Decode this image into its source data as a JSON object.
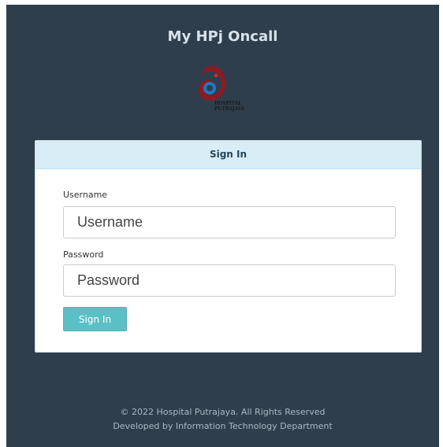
{
  "app": {
    "title": "My HPj Oncall"
  },
  "logo": {
    "line1": "HOSPITAL",
    "line2": "PUTRAJAYA",
    "colors": {
      "maroon": "#8b1a22",
      "blue": "#1e7ac2",
      "accent": "#d32f2f"
    }
  },
  "login": {
    "header": "Sign In",
    "username_label": "Username",
    "username_placeholder": "Username",
    "username_value": "",
    "password_label": "Password",
    "password_placeholder": "Password",
    "password_value": "",
    "submit_label": "Sign In"
  },
  "footer": {
    "copyright": "© 2022 Hospital Putrajaya. All Rights Reserved",
    "developer": "Developed by Information Technology Department"
  },
  "colors": {
    "background": "#2f3e4d",
    "card_header": "#d9edf7",
    "button": "#5bc0c5"
  }
}
